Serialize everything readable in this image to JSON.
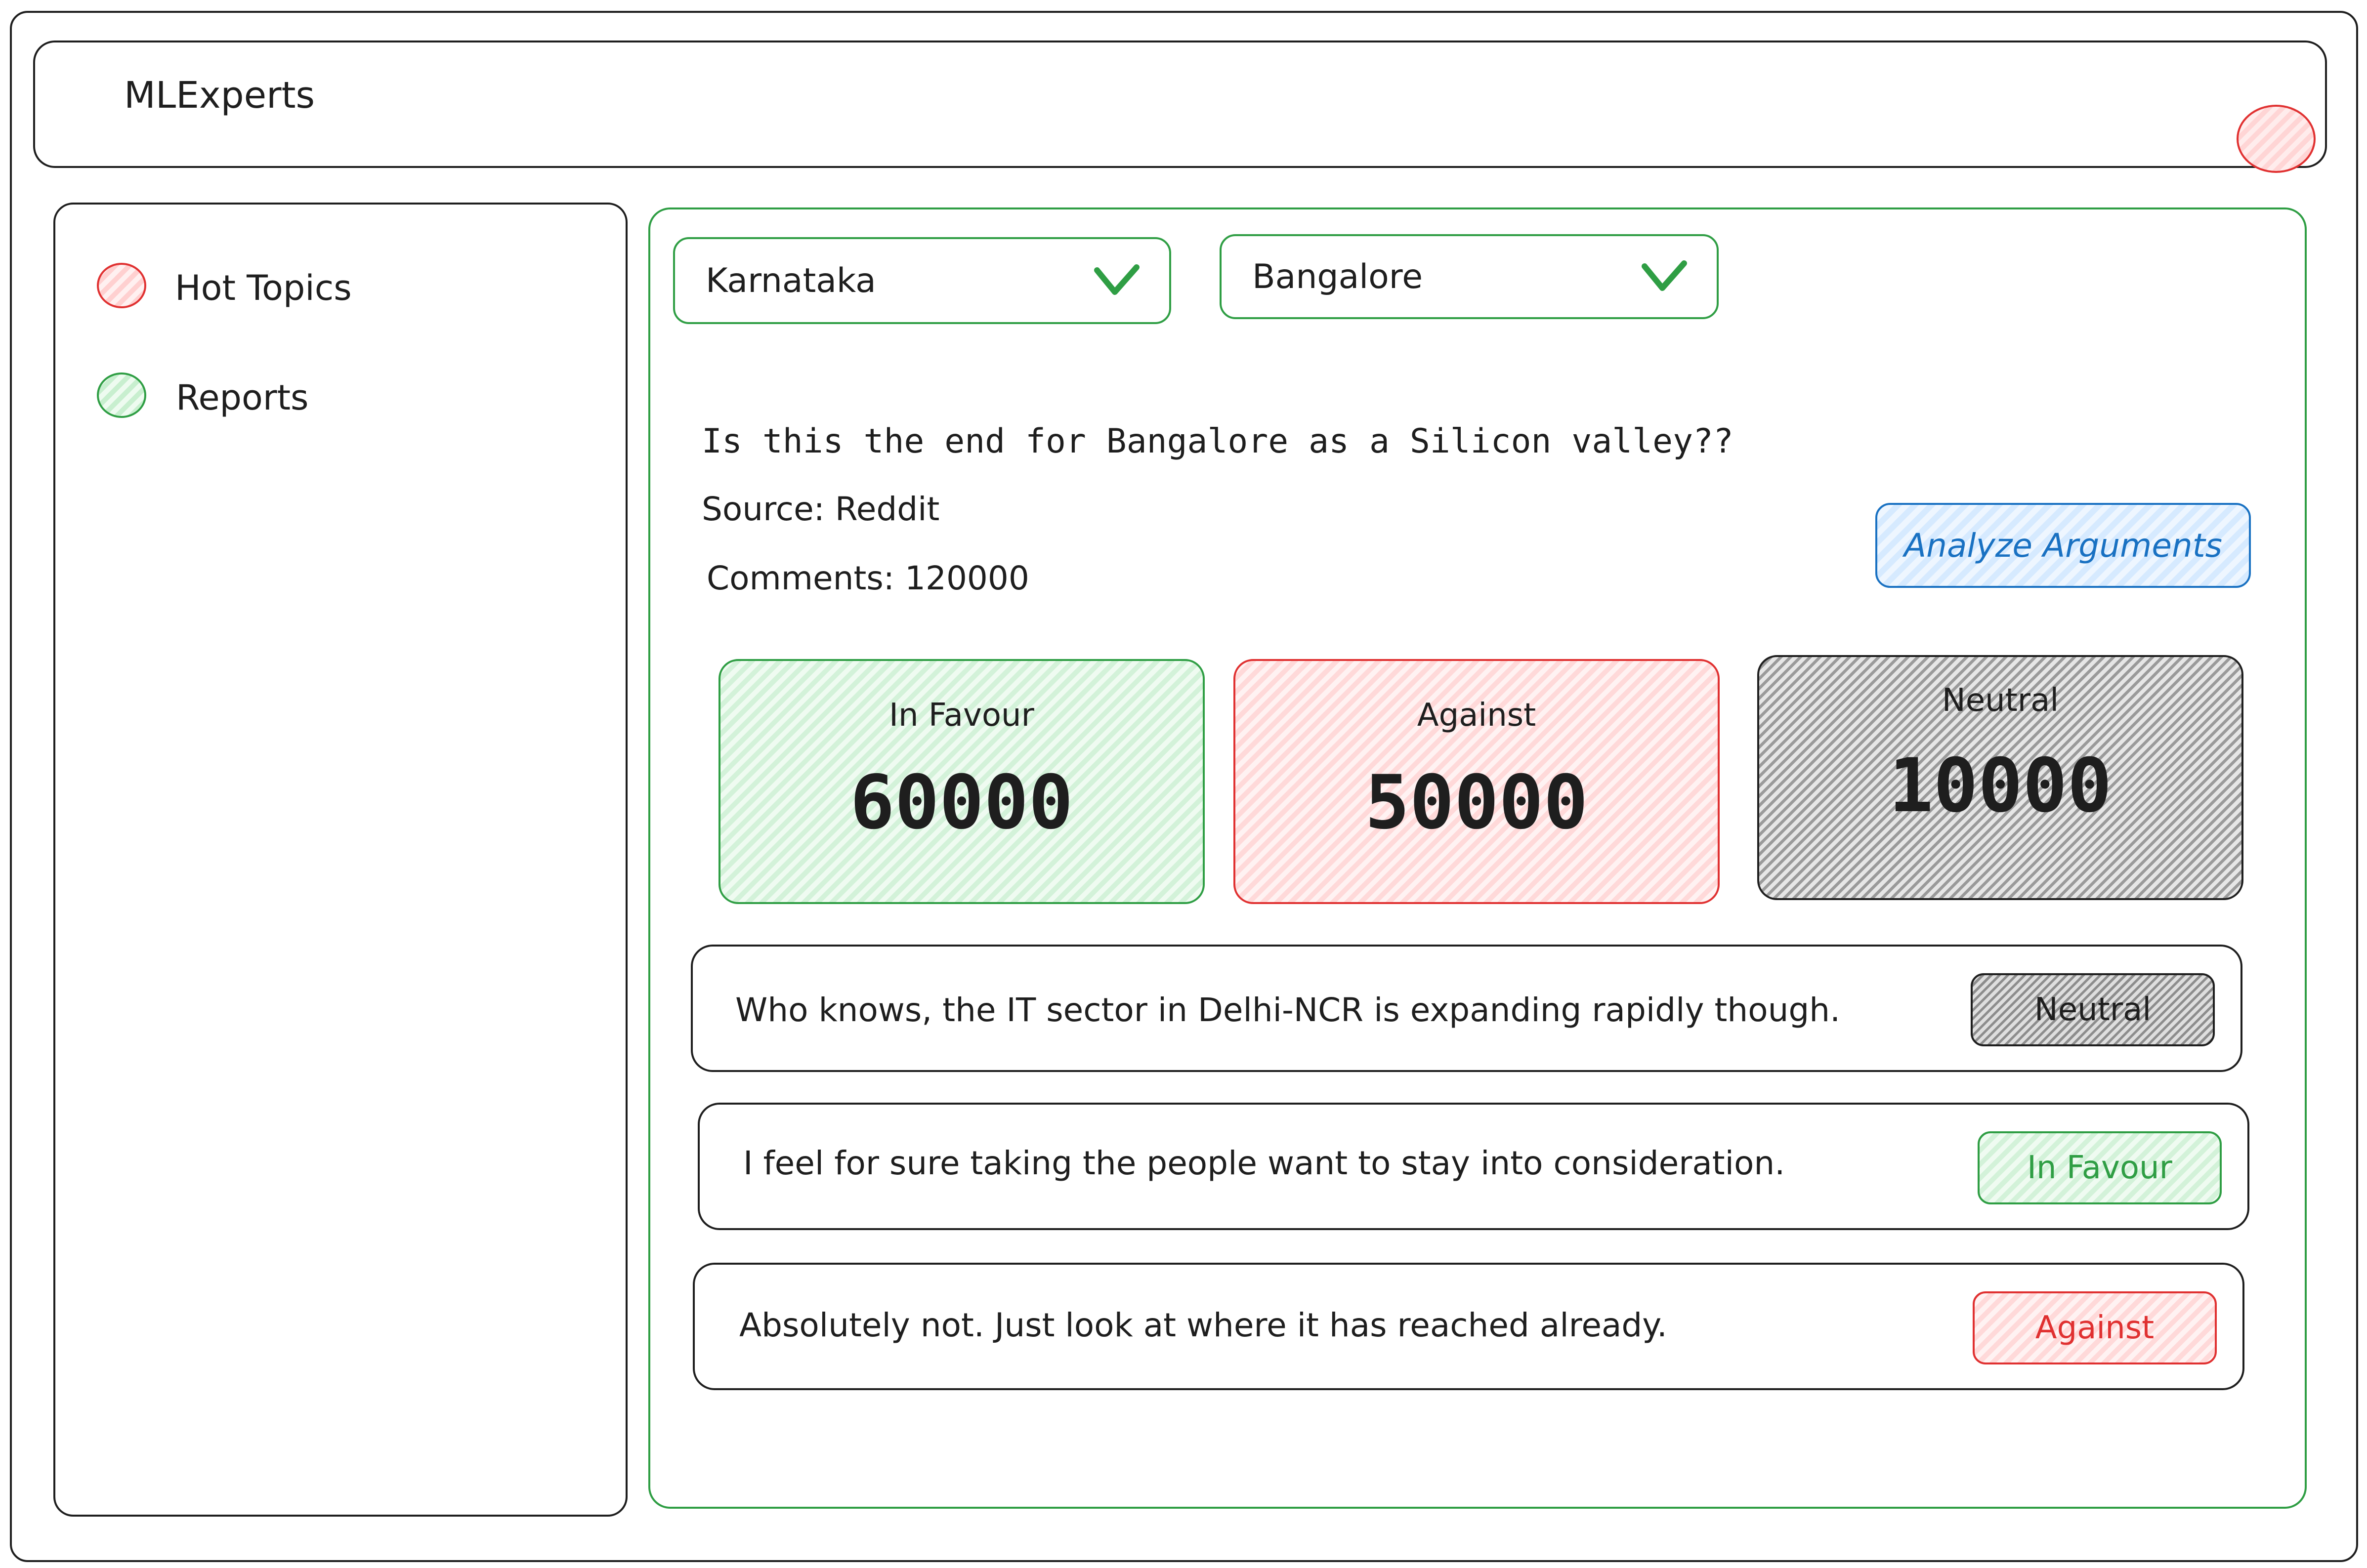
{
  "app": {
    "title": "MLExperts",
    "avatar_icon": "user-avatar-circle"
  },
  "sidebar": {
    "items": [
      {
        "label": "Hot Topics",
        "icon": "red-dot-icon",
        "color": "#e03131"
      },
      {
        "label": "Reports",
        "icon": "green-dot-icon",
        "color": "#2f9e44"
      }
    ]
  },
  "filters": {
    "state": {
      "value": "Karnataka",
      "icon": "chevron-down-icon"
    },
    "city": {
      "value": "Bangalore",
      "icon": "chevron-down-icon"
    }
  },
  "topic": {
    "question": "Is this the end for Bangalore as a Silicon valley??",
    "source": "Source: Reddit",
    "comments": "Comments: 120000"
  },
  "actions": {
    "analyze_label": "Analyze Arguments"
  },
  "summary": {
    "favour": {
      "label": "In Favour",
      "value": "60000",
      "color": "#2f9e44"
    },
    "against": {
      "label": "Against",
      "value": "50000",
      "color": "#e03131"
    },
    "neutral": {
      "label": "Neutral",
      "value": "10000",
      "color": "#1e1e1e"
    }
  },
  "comments": [
    {
      "text": "Who knows, the IT sector in Delhi-NCR is expanding rapidly though.",
      "tag": "Neutral"
    },
    {
      "text": "I feel for sure taking the people want to stay into consideration.",
      "tag": "In Favour"
    },
    {
      "text": "Absolutely not. Just look at where it has reached already.",
      "tag": "Against"
    }
  ]
}
